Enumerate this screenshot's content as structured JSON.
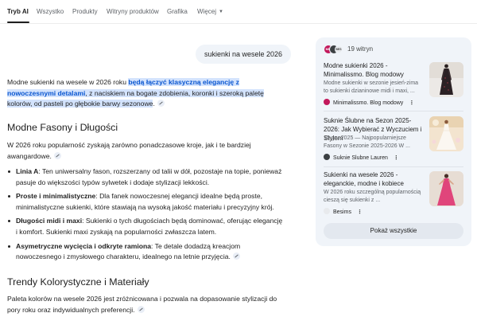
{
  "nav": {
    "tabs": [
      "Tryb AI",
      "Wszystko",
      "Produkty",
      "Witryny produktów",
      "Grafika"
    ],
    "more_label": "Więcej"
  },
  "query": "sukienki na wesele 2026",
  "answer": {
    "intro_plain": "Modne sukienki na wesele w 2026 roku ",
    "intro_highlight_a": "będą łączyć klasyczną elegancję z nowoczesnymi detalami",
    "intro_highlight_b": ", z naciskiem na bogate zdobienia, koronki i szeroką paletę kolorów, od pasteli po głębokie barwy sezonowe",
    "intro_end": ".",
    "section1_title": "Modne Fasony i Długości",
    "section1_text": "W 2026 roku popularność zyskają zarówno ponadczasowe kroje, jak i te bardziej awangardowe.",
    "bullets": [
      {
        "term": "Linia A",
        "text": ": Ten uniwersalny fason, rozszerzany od talii w dół, pozostaje na topie, ponieważ pasuje do większości typów sylwetek i dodaje stylizacji lekkości."
      },
      {
        "term": "Proste i minimalistyczne",
        "text": ": Dla fanek nowoczesnej elegancji idealne będą proste, minimalistyczne sukienki, które stawiają na wysoką jakość materiału i precyzyjny krój."
      },
      {
        "term": "Długości midi i maxi",
        "text": ": Sukienki o tych długościach będą dominować, oferując elegancję i komfort. Sukienki maxi zyskają na popularności zwłaszcza latem."
      },
      {
        "term": "Asymetryczne wycięcia i odkryte ramiona",
        "text": ": Te detale dodadzą kreacjom nowoczesnego i zmysłowego charakteru, idealnego na letnie przyjęcia."
      }
    ],
    "section2_title": "Trendy Kolorystyczne i Materiały",
    "section2_text": "Paleta kolorów na wesele 2026 jest zróżnicowana i pozwala na dopasowanie stylizacji do pory roku oraz indywidualnych preferencji."
  },
  "panel": {
    "pages_count": "19 witryn",
    "avatar_labels": [
      "MM",
      "",
      "BES"
    ],
    "sources": [
      {
        "title": "Modne sukienki 2026 - Minimalissmo. Blog modowy",
        "snippet": "Modne sukienki w sezonie jesień-zima to sukienki dzianinowe midi i maxi, ...",
        "site": "Minimalissmo. Blog modowy",
        "fav_color": "#c2185b",
        "thumb": "dark-dress"
      },
      {
        "title": "Suknie Ślubne na Sezon 2025-2026: Jak Wybierać z Wyczuciem i Stylem",
        "snippet": "10 gru 2025 — Najpopularniejsze Fasony w Sezonie 2025-2026 W ...",
        "site": "Suknie Slubne Lauren",
        "fav_color": "#3c4043",
        "thumb": "wedding-gown"
      },
      {
        "title": "Sukienki na wesele 2026 - eleganckie, modne i kobiece",
        "snippet": "W 2026 roku szczególną popularnością cieszą się sukienki z ...",
        "site": "Besims",
        "fav_color": "#e8eaed",
        "thumb": "pink-dress"
      }
    ],
    "show_all_label": "Pokaż wszystkie"
  }
}
